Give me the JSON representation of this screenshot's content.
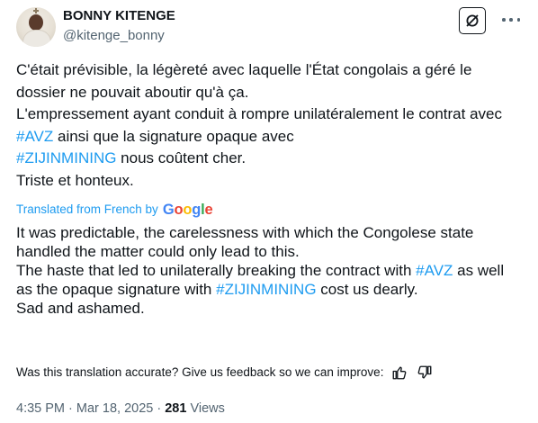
{
  "author": {
    "name": "BONNY KITENGE",
    "handle": "@kitenge_bonny"
  },
  "original_text": {
    "line1": "C'était prévisible, la légèreté avec laquelle l'État congolais a géré le dossier ne pouvait aboutir qu'à ça.",
    "line2_a": "L'empressement ayant conduit à rompre unilatéralement le contrat avec ",
    "line2_tag": "#AVZ",
    "line2_b": " ainsi que la signature opaque avec ",
    "line2_tag2": "#ZIJINMINING",
    "line2_c": " nous coûtent cher.",
    "line3": "Triste et honteux."
  },
  "translation_label": "Translated from French by",
  "google_wordmark": "Google",
  "translated_text": {
    "line1": "It was predictable, the carelessness with which the Congolese state handled the matter could only lead to this.",
    "line2_a": "The haste that led to unilaterally breaking the contract with ",
    "line2_tag": "#AVZ",
    "line2_b": " as well as the opaque signature with ",
    "line2_tag2": "#ZIJINMINING",
    "line2_c": " cost us dearly.",
    "line3": "Sad and ashamed."
  },
  "feedback_prompt": "Was this translation accurate? Give us feedback so we can improve:",
  "meta": {
    "time": "4:35 PM",
    "separator": " · ",
    "date": "Mar 18, 2025",
    "views_count": "281",
    "views_label": " Views"
  },
  "colors": {
    "link": "#1d9bf0",
    "secondary_text": "#536471",
    "text": "#0f1419"
  },
  "icons": [
    "grok-icon",
    "more-icon",
    "thumbs-up-icon",
    "thumbs-down-icon"
  ]
}
